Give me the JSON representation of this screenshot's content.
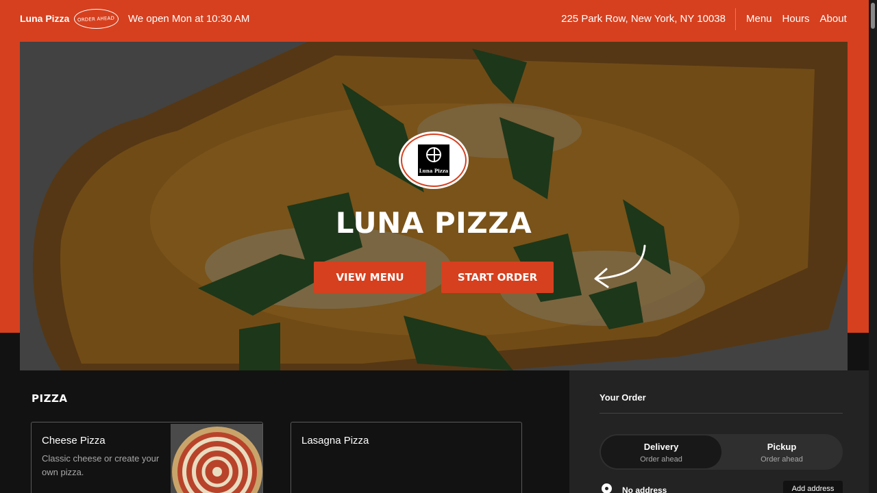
{
  "header": {
    "brand": "Luna Pizza",
    "order_badge": "ORDER AHEAD",
    "hours": "We open Mon at 10:30 AM",
    "address": "225 Park Row, New York, NY 10038",
    "nav": [
      "Menu",
      "Hours",
      "About"
    ]
  },
  "hero": {
    "logo_text": "Luna Pizza",
    "title": "LUNA PIZZA",
    "view_menu": "VIEW MENU",
    "start_order": "START ORDER"
  },
  "menu": {
    "section": "PIZZA",
    "items": [
      {
        "name": "Cheese Pizza",
        "description": "Classic cheese or create your own pizza."
      },
      {
        "name": "Lasagna Pizza",
        "description": ""
      }
    ]
  },
  "order": {
    "title": "Your Order",
    "delivery": {
      "label": "Delivery",
      "sub": "Order ahead"
    },
    "pickup": {
      "label": "Pickup",
      "sub": "Order ahead"
    },
    "address_status": "No address",
    "add_address": "Add address"
  },
  "colors": {
    "accent": "#d6401f",
    "dark": "#121212",
    "panel": "#232323"
  }
}
